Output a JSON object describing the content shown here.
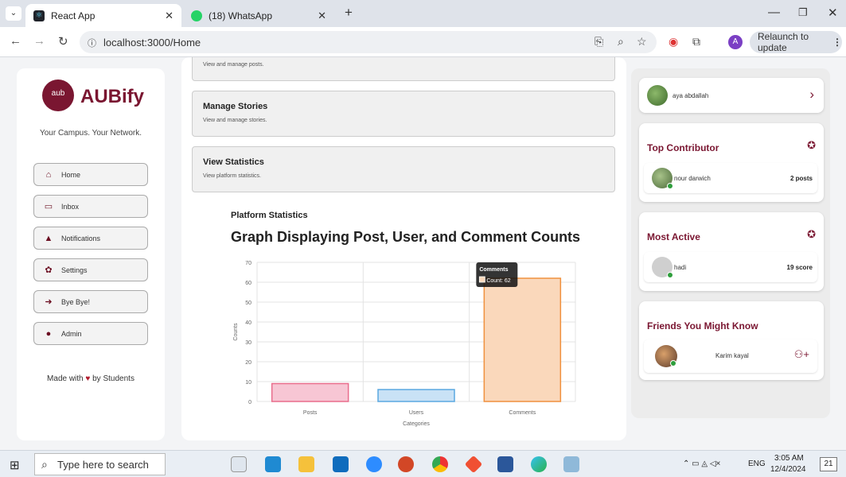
{
  "browser": {
    "tabs": [
      {
        "title": "React App",
        "favicon": "react-icon",
        "active": true
      },
      {
        "title": "(18) WhatsApp",
        "favicon": "whatsapp-icon",
        "active": false
      }
    ],
    "url": "localhost:3000/Home",
    "relaunch_label": "Relaunch to update",
    "profile_initial": "A"
  },
  "sidebar": {
    "logo_text": "aub",
    "brand": "AUBify",
    "tagline": "Your Campus. Your Network.",
    "items": [
      {
        "label": "Home",
        "icon": "home-icon"
      },
      {
        "label": "Inbox",
        "icon": "inbox-icon"
      },
      {
        "label": "Notifications",
        "icon": "bell-icon"
      },
      {
        "label": "Settings",
        "icon": "gear-icon"
      },
      {
        "label": "Bye Bye!",
        "icon": "logout-icon"
      },
      {
        "label": "Admin",
        "icon": "admin-icon"
      }
    ],
    "footer_prefix": "Made with",
    "footer_suffix": "by Students"
  },
  "main": {
    "cards": [
      {
        "title": "",
        "subtitle": "View and manage posts."
      },
      {
        "title": "Manage Stories",
        "subtitle": "View and manage stories."
      },
      {
        "title": "View Statistics",
        "subtitle": "View platform statistics."
      }
    ],
    "stats_heading": "Platform Statistics",
    "graph_title": "Graph Displaying Post, User, and Comment Counts",
    "tooltip": {
      "title": "Comments",
      "label": "Count: 62"
    }
  },
  "chart_data": {
    "type": "bar",
    "categories": [
      "Posts",
      "Users",
      "Comments"
    ],
    "series": [
      {
        "values": [
          9,
          6,
          62
        ]
      }
    ],
    "colors": [
      "#f7c6d4",
      "#c9e2f6",
      "#fad8bb"
    ],
    "border_colors": [
      "#e96d8c",
      "#5aa8e0",
      "#f0913e"
    ],
    "xlabel": "Categories",
    "ylabel": "Counts",
    "ylim": [
      0,
      70
    ],
    "yticks": [
      "0",
      "10",
      "20",
      "30",
      "40",
      "50",
      "60",
      "70"
    ],
    "grid": true
  },
  "rightbar": {
    "user": {
      "name": "aya abdallah"
    },
    "top_contributor": {
      "heading": "Top Contributor",
      "name": "nour darwich",
      "value": "2 posts"
    },
    "most_active": {
      "heading": "Most Active",
      "name": "hadi",
      "value": "19 score"
    },
    "friends": {
      "heading": "Friends You Might Know",
      "name": "Karim kayal"
    }
  },
  "taskbar": {
    "search_placeholder": "Type here to search",
    "time": "3:05 AM",
    "date": "12/4/2024",
    "language": "ENG",
    "notifications": "21"
  }
}
